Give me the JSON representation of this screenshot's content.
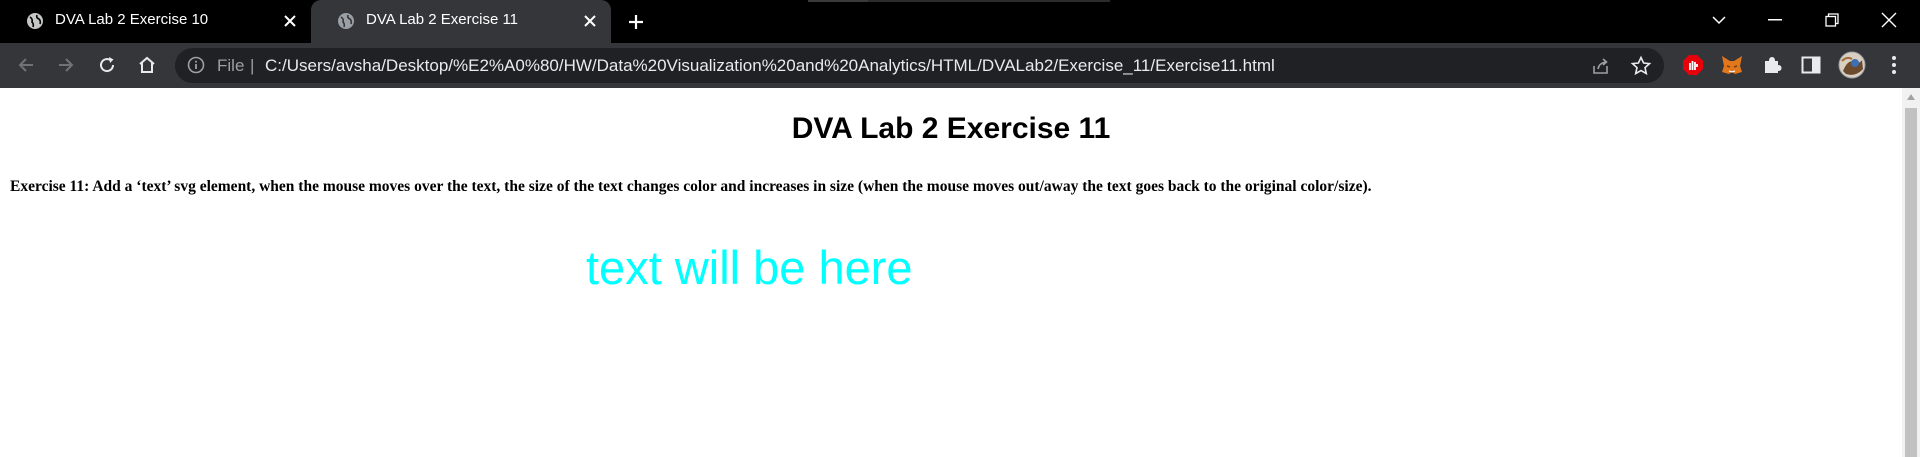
{
  "browser": {
    "tabs": [
      {
        "title": "DVA Lab 2 Exercise 10",
        "active": false
      },
      {
        "title": "DVA Lab 2 Exercise 11",
        "active": true
      }
    ],
    "omnibox": {
      "scheme_label": "File",
      "separator": "|",
      "url": "C:/Users/avsha/Desktop/%E2%A0%80/HW/Data%20Visualization%20and%20Analytics/HTML/DVALab2/Exercise_11/Exercise11.html"
    },
    "icons": {
      "favicon": "globe-icon",
      "tab_close": "close-icon",
      "new_tab": "plus-icon",
      "tab_search": "chevron-down-icon",
      "minimize": "minimize-icon",
      "restore": "restore-icon",
      "close_window": "close-icon",
      "back": "arrow-left-icon",
      "forward": "arrow-right-icon",
      "reload": "reload-icon",
      "home": "home-icon",
      "site_info": "info-icon",
      "share": "share-icon",
      "bookmark": "star-icon",
      "extensions": [
        "adblock-icon",
        "metamask-icon",
        "puzzle-icon",
        "sidepanel-icon",
        "avatar",
        "kebab-menu-icon"
      ]
    },
    "colors": {
      "tabstrip_bg": "#000000",
      "toolbar_bg": "#35363a",
      "omnibox_bg": "#202124",
      "url_text": "#e8eaed"
    }
  },
  "page": {
    "heading": "DVA Lab 2 Exercise 11",
    "description": "Exercise 11: Add a ‘text’ svg element, when the mouse moves over the text, the size of the text changes color and increases in size (when the mouse moves out/away the text goes back to the original color/size).",
    "svg_text": {
      "content": "text will be here",
      "color": "#00ffff"
    }
  }
}
